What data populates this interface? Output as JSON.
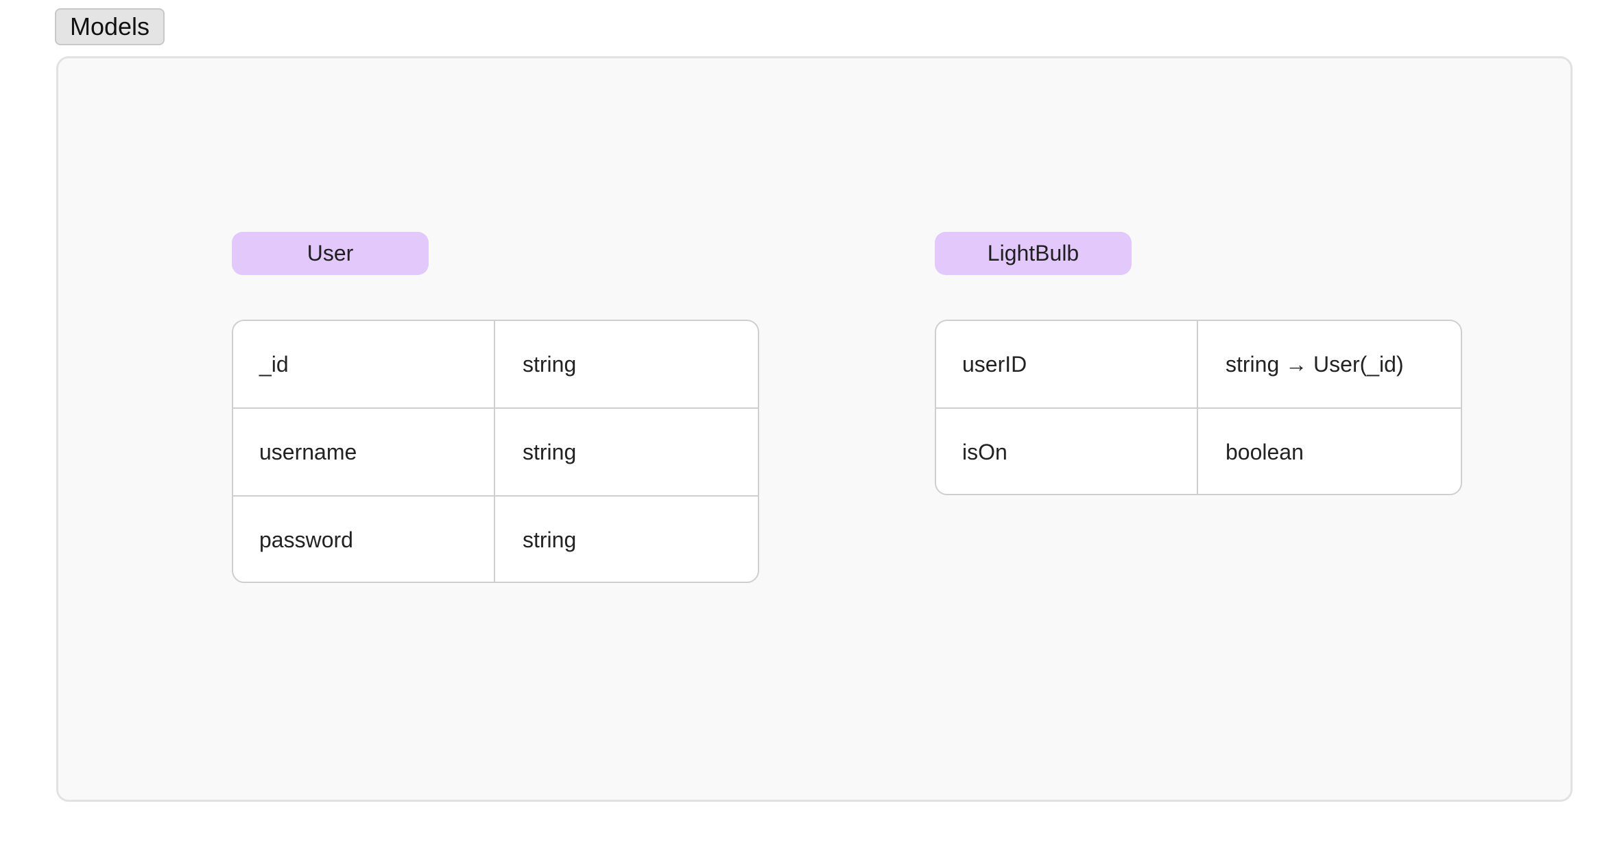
{
  "tab": {
    "label": "Models"
  },
  "models": [
    {
      "name": "User",
      "fields": [
        {
          "name": "_id",
          "type": "string"
        },
        {
          "name": "username",
          "type": "string"
        },
        {
          "name": "password",
          "type": "string"
        }
      ]
    },
    {
      "name": "LightBulb",
      "fields": [
        {
          "name": "userID",
          "type": "string → User(_id)"
        },
        {
          "name": "isOn",
          "type": "boolean"
        }
      ]
    }
  ],
  "colors": {
    "label_bg": "#e2c8fb",
    "canvas_bg": "#f9f9f9",
    "border": "#cfcfcf"
  }
}
